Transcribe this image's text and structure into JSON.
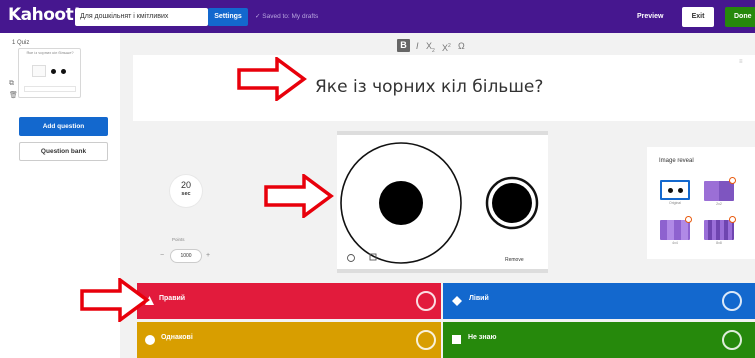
{
  "topbar": {
    "logo": "Kahoot!",
    "quiz_title": "Для дошкільнят і кмітливих",
    "settings_label": "Settings",
    "saved_status": "✓  Saved to: My drafts",
    "preview_label": "Preview",
    "exit_label": "Exit",
    "done_label": "Done"
  },
  "sidebar": {
    "quiz_label": "1 Quiz",
    "thumb_title": "Яке із чорних кіл більше?",
    "add_question_label": "Add question",
    "question_bank_label": "Question bank"
  },
  "toolbar": {
    "bold": "B",
    "italic": "I",
    "subscript": "X",
    "sub_mark": "2",
    "superscript": "X",
    "sup_mark": "2",
    "special": "Ω"
  },
  "question": {
    "text": "Яке із чорних кіл більше?"
  },
  "timer": {
    "value": "20",
    "unit": "sec"
  },
  "points": {
    "label": "Points",
    "value": "1000",
    "minus": "−",
    "plus": "+"
  },
  "media": {
    "remove_label": "Remove"
  },
  "image_reveal": {
    "label": "Image reveal",
    "options": [
      "Original",
      "2x2",
      "4x4",
      "8x8"
    ]
  },
  "answers": [
    {
      "label": "Правий",
      "color": "#e21b3c",
      "shape": "triangle"
    },
    {
      "label": "Лівий",
      "color": "#1368ce",
      "shape": "diamond"
    },
    {
      "label": "Однакові",
      "color": "#d89e00",
      "shape": "circle"
    },
    {
      "label": "Не знаю",
      "color": "#26890c",
      "shape": "square"
    }
  ],
  "colors": {
    "brand": "#46178f",
    "accent_blue": "#1368ce",
    "arrow": "#e8000b"
  }
}
